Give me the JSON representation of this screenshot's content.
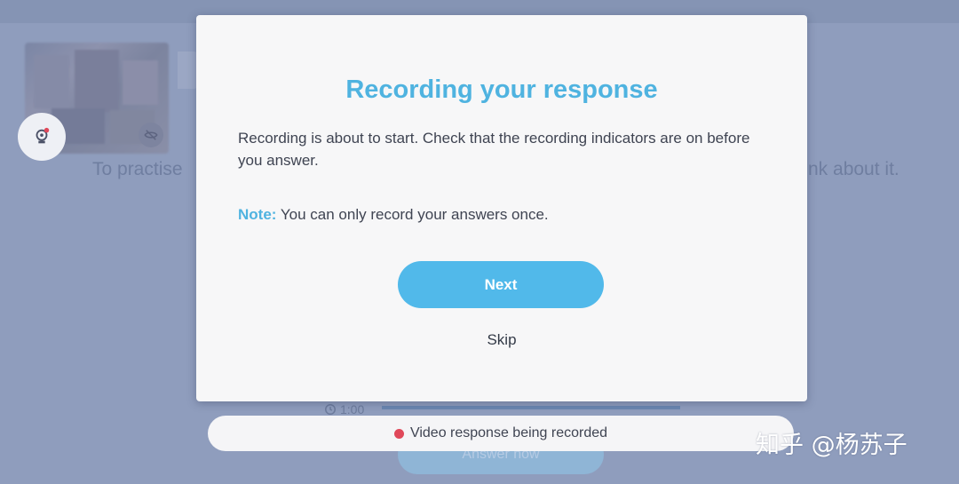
{
  "background": {
    "instruction_left": "To practise",
    "instruction_right": "nk about it.",
    "timer": "1:00",
    "answer_button": "Answer now"
  },
  "modal": {
    "title": "Recording your response",
    "body": "Recording is about to start. Check that the recording indicators are on before you answer.",
    "note_label": "Note:",
    "note_text": "You can only record your answers once.",
    "next_label": "Next",
    "skip_label": "Skip"
  },
  "status": {
    "text": "Video response being recorded",
    "dot_color": "#e0485a"
  },
  "watermark": "知乎 @杨苏子",
  "colors": {
    "accent": "#4fb3e0",
    "button": "#51b9ea",
    "overlay": "#8f9dbd"
  },
  "icons": {
    "camera": "webcam-icon",
    "visibility": "eye-off-icon",
    "clock": "clock-icon"
  }
}
